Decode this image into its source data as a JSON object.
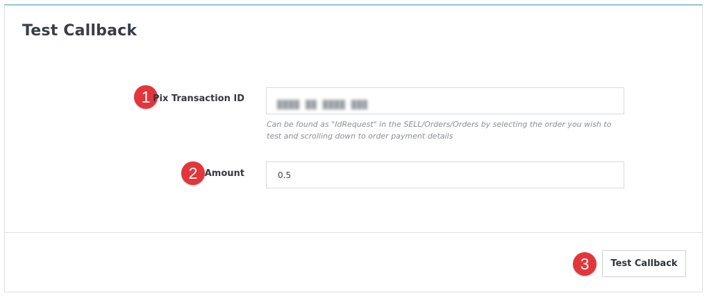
{
  "panel": {
    "title": "Test Callback"
  },
  "form": {
    "transaction_id": {
      "step": "1",
      "label": "Pix Transaction ID",
      "value": "",
      "help": "Can be found as \"IdRequest\" in the SELL/Orders/Orders by selecting the order you wish to test and scrolling down to order payment details"
    },
    "amount": {
      "step": "2",
      "label": "Amount",
      "value": "0.5"
    }
  },
  "footer": {
    "step": "3",
    "submit_label": "Test Callback"
  },
  "colors": {
    "badge": "#e2363c",
    "panel_top_border": "#93c4d8"
  },
  "icons": {
    "step_badges": "numbered-circle-icon"
  }
}
